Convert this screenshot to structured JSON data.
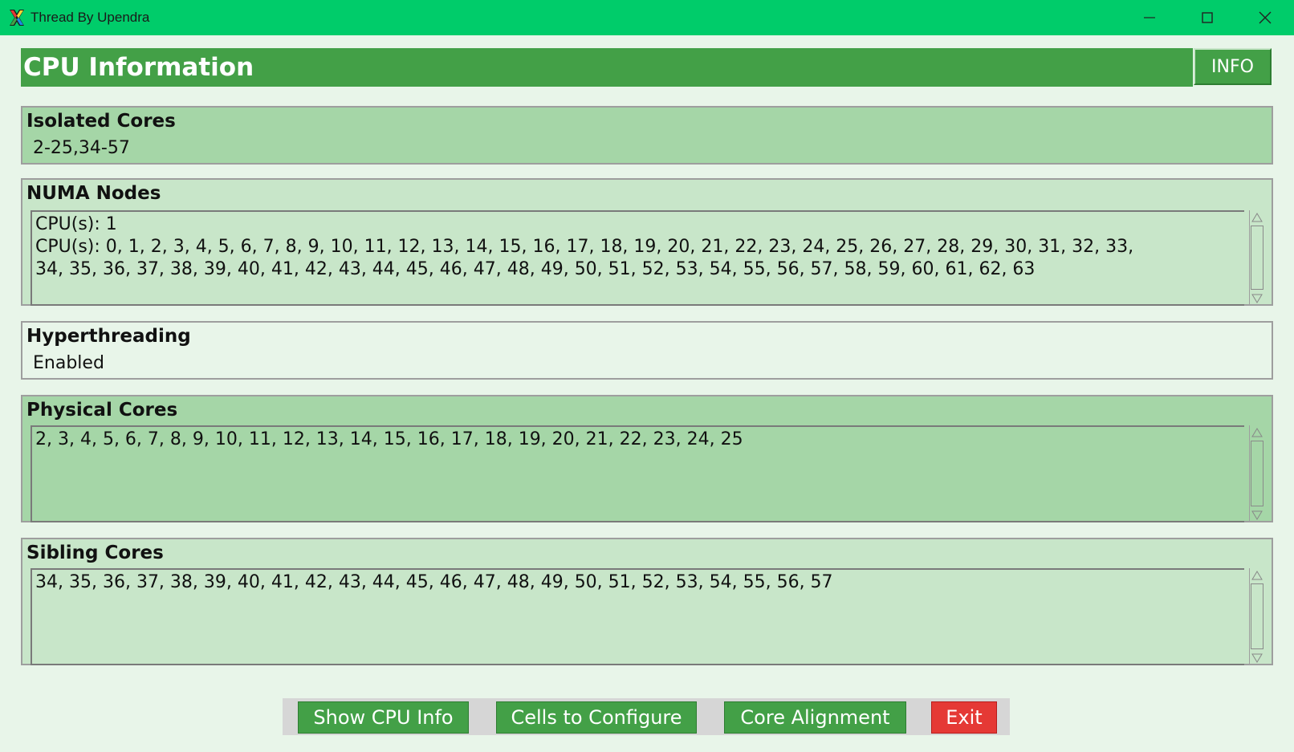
{
  "window": {
    "title": "Thread By Upendra",
    "icon": "x-app-icon",
    "controls": [
      "minimize-icon",
      "maximize-icon",
      "close-icon"
    ]
  },
  "header": {
    "title": "CPU Information",
    "info_label": "INFO"
  },
  "sections": {
    "isolated_cores": {
      "title": "Isolated Cores",
      "value": "2-25,34-57"
    },
    "numa_nodes": {
      "title": "NUMA Nodes",
      "text": "CPU(s): 1\nCPU(s): 0, 1, 2, 3, 4, 5, 6, 7, 8, 9, 10, 11, 12, 13, 14, 15, 16, 17, 18, 19, 20, 21, 22, 23, 24, 25, 26, 27, 28, 29, 30, 31, 32, 33,\n34, 35, 36, 37, 38, 39, 40, 41, 42, 43, 44, 45, 46, 47, 48, 49, 50, 51, 52, 53, 54, 55, 56, 57, 58, 59, 60, 61, 62, 63"
    },
    "hyperthreading": {
      "title": "Hyperthreading",
      "value": "Enabled"
    },
    "physical_cores": {
      "title": "Physical Cores",
      "text": "2, 3, 4, 5, 6, 7, 8, 9, 10, 11, 12, 13, 14, 15, 16, 17, 18, 19, 20, 21, 22, 23, 24, 25"
    },
    "sibling_cores": {
      "title": "Sibling Cores",
      "text": "34, 35, 36, 37, 38, 39, 40, 41, 42, 43, 44, 45, 46, 47, 48, 49, 50, 51, 52, 53, 54, 55, 56, 57"
    }
  },
  "buttons": {
    "show_cpu_info": "Show CPU Info",
    "cells_to_configure": "Cells to Configure",
    "core_alignment": "Core Alignment",
    "exit": "Exit"
  },
  "colors": {
    "titlebar": "#00cc6a",
    "header": "#43a047",
    "panel_medium": "#a5d6a7",
    "panel_light": "#c8e6c9",
    "panel_pale": "#e8f5e9",
    "exit": "#e53935"
  }
}
